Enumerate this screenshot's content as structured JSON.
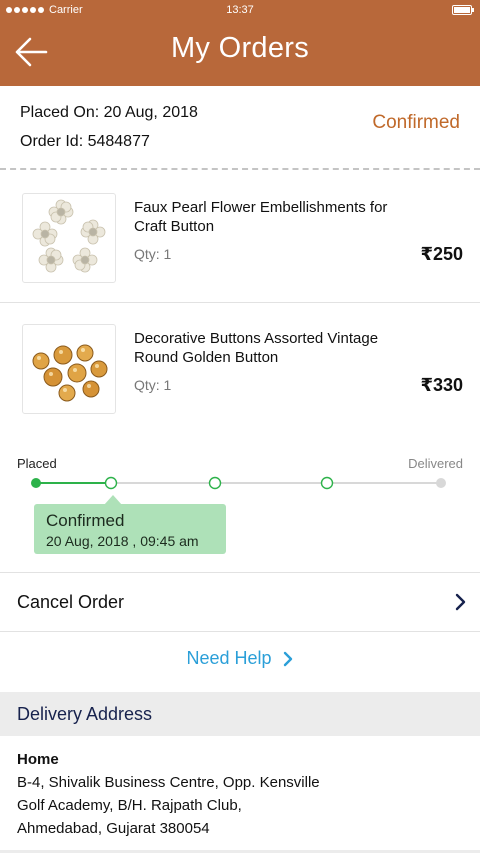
{
  "status_bar": {
    "carrier": "Carrier",
    "time": "13:37"
  },
  "header": {
    "title": "My Orders",
    "back_icon": "arrow-left-icon"
  },
  "order": {
    "placed_on": "Placed On: 20 Aug, 2018",
    "order_id": "Order Id: 5484877",
    "status": "Confirmed",
    "status_color": "#c0692a"
  },
  "items": [
    {
      "name": "Faux Pearl Flower Embellishments for Craft Button",
      "qty": "Qty: 1",
      "price": "₹250",
      "image": "pearl-flower-buttons-image"
    },
    {
      "name": "Decorative Buttons Assorted Vintage Round Golden Button",
      "qty": "Qty: 1",
      "price": "₹330",
      "image": "golden-buttons-image"
    }
  ],
  "tracker": {
    "start_label": "Placed",
    "end_label": "Delivered",
    "steps_total": 5,
    "steps_completed": 2,
    "active_color": "#2db24a",
    "pending_color": "#d8d8d8",
    "tooltip_status": "Confirmed",
    "tooltip_date": "20 Aug, 2018 , 09:45 am"
  },
  "actions": {
    "cancel_label": "Cancel Order",
    "help_label": "Need Help"
  },
  "delivery": {
    "section_title": "Delivery Address",
    "type": "Home",
    "line1": "B-4, Shivalik Business Centre, Opp. Kensville",
    "line2": "Golf Academy, B/H. Rajpath Club,",
    "line3": "Ahmedabad, Gujarat 380054"
  },
  "colors": {
    "brand": "#b8683a",
    "link": "#2b9fd8",
    "tooltip_bg": "#aee1b8"
  }
}
